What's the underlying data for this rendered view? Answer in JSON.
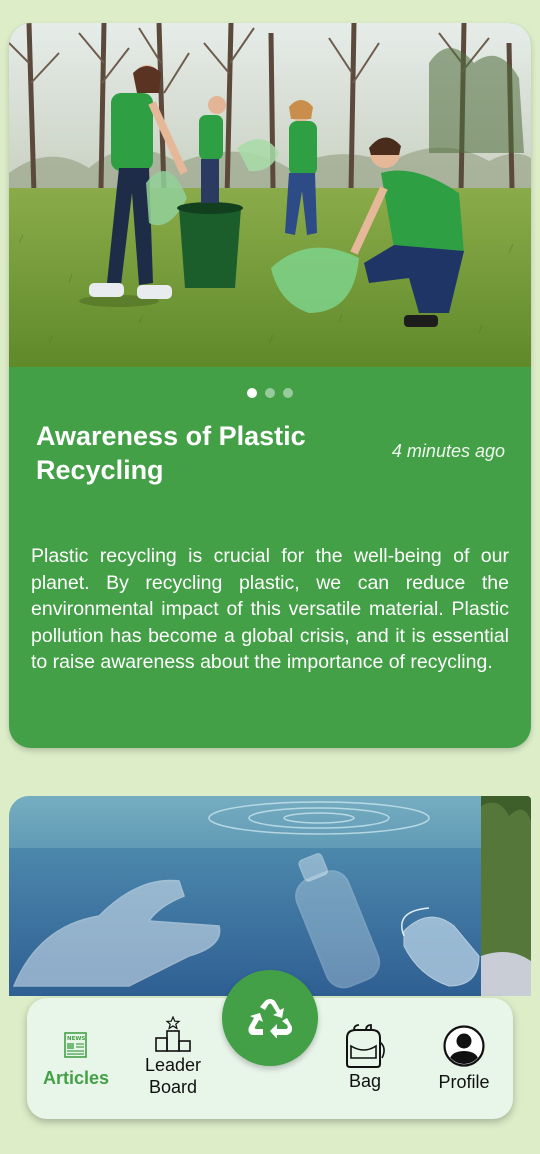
{
  "article": {
    "title": "Awareness of Plastic Recycling",
    "time": "4 minutes ago",
    "body": "Plastic recycling is crucial for the well-being of our planet. By recycling plastic, we can reduce the environmental impact of this versatile material. Plastic pollution has become a global crisis, and it is essential to raise awareness about the importance of recycling.",
    "carousel_page": 1,
    "carousel_count": 3
  },
  "nav": {
    "articles": "Articles",
    "leaderboard_line1": "Leader",
    "leaderboard_line2": "Board",
    "bag": "Bag",
    "profile": "Profile",
    "news_icon_text": "NEWS"
  },
  "colors": {
    "background": "#dcedc8",
    "card": "#43a047",
    "nav_background": "#e8f5e9",
    "accent": "#43a047"
  },
  "icons": [
    "news-icon",
    "podium-icon",
    "recycle-icon",
    "backpack-icon",
    "profile-icon"
  ]
}
